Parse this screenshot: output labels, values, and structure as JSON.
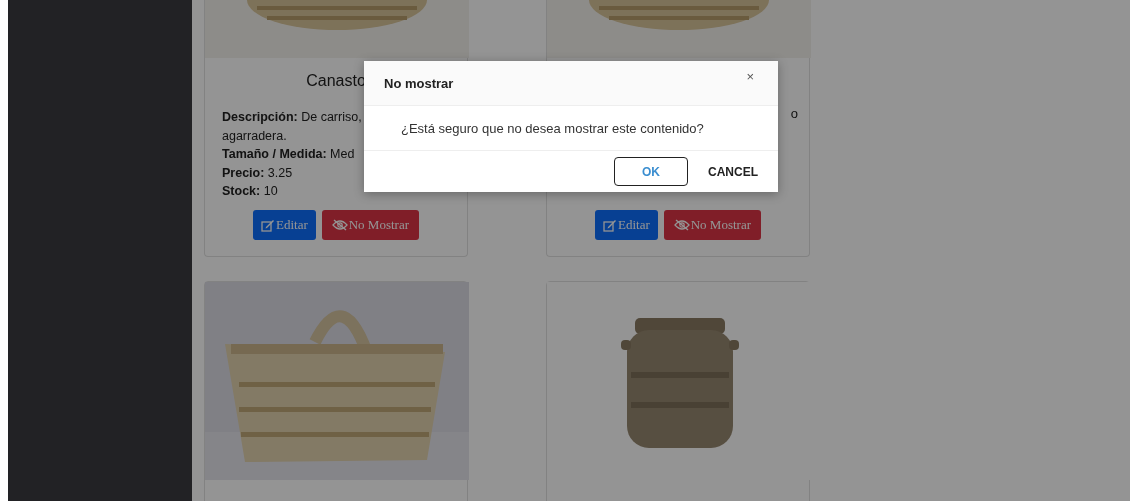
{
  "cards": [
    {
      "picture": {
        "kind": "picture"
      },
      "title": "Canasto",
      "lines": [
        "**Descripción:** De carriso,",
        "agarradera.",
        "**Tamaño / Medida:** Med",
        "**Precio:** 3.25",
        "**Stock:** 10"
      ],
      "buttons": [
        {
          "label": "Editar",
          "kind": "edit"
        },
        {
          "label": "No Mostrar",
          "kind": "hide"
        }
      ]
    },
    {
      "picture": {
        "kind": "picture"
      },
      "cut_text": "o",
      "buttons": [
        {
          "label": "Editar",
          "kind": "edit"
        },
        {
          "label": "No Mostrar",
          "kind": "hide"
        }
      ]
    },
    {
      "picture": {
        "kind": "picture"
      }
    },
    {
      "picture": {
        "kind": "picture"
      }
    }
  ],
  "dialog": {
    "title": "No mostrar",
    "close": "×",
    "message": "¿Está seguro que no desea mostrar este contenido?",
    "buttons": [
      {
        "label": "OK",
        "kind": "outlined"
      },
      {
        "label": "CANCEL",
        "kind": "text"
      }
    ]
  }
}
